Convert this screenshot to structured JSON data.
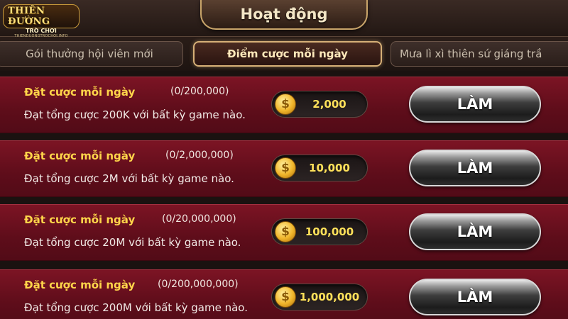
{
  "logo": {
    "line1": "THIÊN ĐƯỜNG",
    "line2": "TRÒ CHƠI",
    "line3": "THIENDUONGTROCHOI.INFO"
  },
  "header": {
    "title": "Hoạt động"
  },
  "tabs": [
    {
      "label": "Gói thưởng hội viên mới",
      "active": false
    },
    {
      "label": "Điểm cược mỗi ngày",
      "active": true
    },
    {
      "label": "Mưa lì xì thiên sứ giáng trầ",
      "active": false
    }
  ],
  "tasks": [
    {
      "name": "Đặt cược mỗi ngày",
      "progress": "(0/200,000)",
      "description": "Đạt tổng cược 200K với bất kỳ game nào.",
      "reward": "2,000",
      "button": "LÀM"
    },
    {
      "name": "Đặt cược mỗi ngày",
      "progress": "(0/2,000,000)",
      "description": "Đạt tổng cược 2M với bất kỳ game nào.",
      "reward": "10,000",
      "button": "LÀM"
    },
    {
      "name": "Đặt cược mỗi ngày",
      "progress": "(0/20,000,000)",
      "description": "Đạt tổng cược 20M với bất kỳ game nào.",
      "reward": "100,000",
      "button": "LÀM"
    },
    {
      "name": "Đặt cược mỗi ngày",
      "progress": "(0/200,000,000)",
      "description": "Đạt tổng cược 200M với bất kỳ game nào.",
      "reward": "1,000,000",
      "button": "LÀM"
    }
  ],
  "icons": {
    "coin": "dollar-coin-icon"
  },
  "colors": {
    "row_bg": "#6a1020",
    "task_name": "#ffd54a",
    "reward_text": "#ffe15a",
    "tab_active_border": "#d6b077"
  }
}
